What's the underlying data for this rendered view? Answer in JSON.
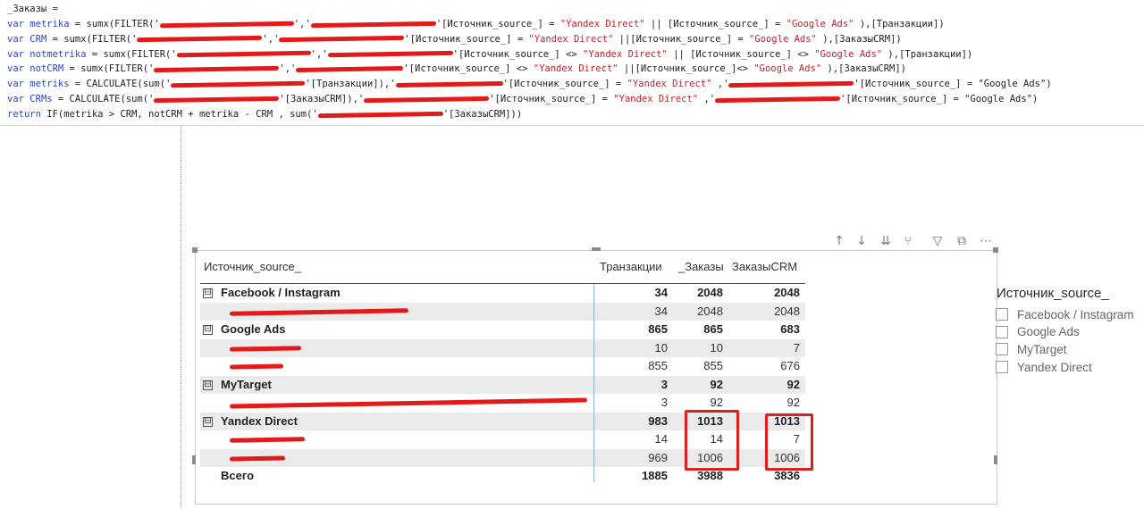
{
  "formula": {
    "measure_name": "_Заказы =",
    "lines": [
      {
        "kw": "var",
        "name": "metrika",
        "pre": " = sumx(FILTER('",
        "mid": "','",
        "post": "'[Источник_source_] = ",
        "s1": "\"Yandex Direct\"",
        "mid2": " || [Источник_source_] = ",
        "s2": "\"Google Ads\"",
        "end": " ),[Транзакции])"
      },
      {
        "kw": "var",
        "name": "CRM",
        "pre": " = sumx(FILTER('",
        "mid": "','",
        "post": "'[Источник_source_] = ",
        "s1": "\"Yandex Direct\"",
        "mid2": " ||[Источник_source_] = ",
        "s2": "\"Google Ads\"",
        "end": " ),[ЗаказыCRM])"
      },
      {
        "kw": "var",
        "name": "notmetrika",
        "pre": " = sumx(FILTER('",
        "mid": "','",
        "post": "'[Источник_source_] <> ",
        "s1": "\"Yandex Direct\"",
        "mid2": " || [Источник_source_] <> ",
        "s2": "\"Google Ads\"",
        "end": " ),[Транзакции])"
      },
      {
        "kw": "var",
        "name": "notCRM",
        "pre": " = sumx(FILTER('",
        "mid": "','",
        "post": "'[Источник_source_] <> ",
        "s1": "\"Yandex Direct\"",
        "mid2": " ||[Источник_source_]<> ",
        "s2": "\"Google Ads\"",
        "end": " ),[ЗаказыCRM])"
      },
      {
        "kw": "var",
        "name": "metriks",
        "pre": " = CALCULATE(sum('",
        "mid": "'[Транзакции]),'",
        "post": "'[Источник_source_] = ",
        "s1": "\"Yandex Direct\"",
        "mid2": " ,'",
        "s2": "",
        "end": "'[Источник_source_] = \"Google Ads\")"
      },
      {
        "kw": "var",
        "name": "CRMs",
        "pre": " = CALCULATE(sum('",
        "mid": "'[ЗаказыCRM]),'",
        "post": "'[Источник_source_] = ",
        "s1": "\"Yandex Direct\"",
        "mid2": " ,'",
        "s2": "",
        "end": "'[Источник_source_] = \"Google Ads\")"
      }
    ],
    "return_kw": "return",
    "return_text": " IF(metrika > CRM, notCRM + metrika - CRM , sum('",
    "return_end": "'[ЗаказыCRM]))"
  },
  "table": {
    "headers": [
      "Источник_source_",
      "Транзакции",
      "_Заказы",
      "ЗаказыCRM"
    ],
    "rows": [
      {
        "type": "parent",
        "label": "Facebook / Instagram",
        "v": [
          "34",
          "2048",
          "2048"
        ]
      },
      {
        "type": "child",
        "label": "",
        "v": [
          "34",
          "2048",
          "2048"
        ]
      },
      {
        "type": "parent",
        "label": "Google Ads",
        "v": [
          "865",
          "865",
          "683"
        ]
      },
      {
        "type": "child",
        "label": "",
        "v": [
          "10",
          "10",
          "7"
        ]
      },
      {
        "type": "child",
        "label": "",
        "v": [
          "855",
          "855",
          "676"
        ]
      },
      {
        "type": "parent",
        "label": "MyTarget",
        "v": [
          "3",
          "92",
          "92"
        ]
      },
      {
        "type": "child",
        "label": "",
        "v": [
          "3",
          "92",
          "92"
        ]
      },
      {
        "type": "parent",
        "label": "Yandex Direct",
        "v": [
          "983",
          "1013",
          "1013"
        ]
      },
      {
        "type": "child",
        "label": "",
        "v": [
          "14",
          "14",
          "7"
        ]
      },
      {
        "type": "child",
        "label": "",
        "v": [
          "969",
          "1006",
          "1006"
        ]
      },
      {
        "type": "total",
        "label": "Всего",
        "v": [
          "1885",
          "3988",
          "3836"
        ]
      }
    ],
    "expand_symbol": "⊟"
  },
  "slicer": {
    "title": "Источник_source_",
    "items": [
      "Facebook / Instagram",
      "Google Ads",
      "MyTarget",
      "Yandex Direct"
    ]
  },
  "toolbar": {
    "icons": [
      "arrow-up-icon",
      "arrow-down-icon",
      "double-arrow-down-icon",
      "expand-hierarchy-icon",
      "filter-icon",
      "focus-mode-icon",
      "more-options-icon"
    ],
    "glyphs": [
      "↑",
      "↓",
      "⇊",
      "⑂",
      "▽",
      "⧉",
      "⋯"
    ]
  },
  "colors": {
    "keyword": "#2b47c9",
    "string": "#c7202a",
    "redaction": "#e21a1a",
    "highlight_box": "#e01e1e",
    "row_alt": "#ebebeb"
  }
}
